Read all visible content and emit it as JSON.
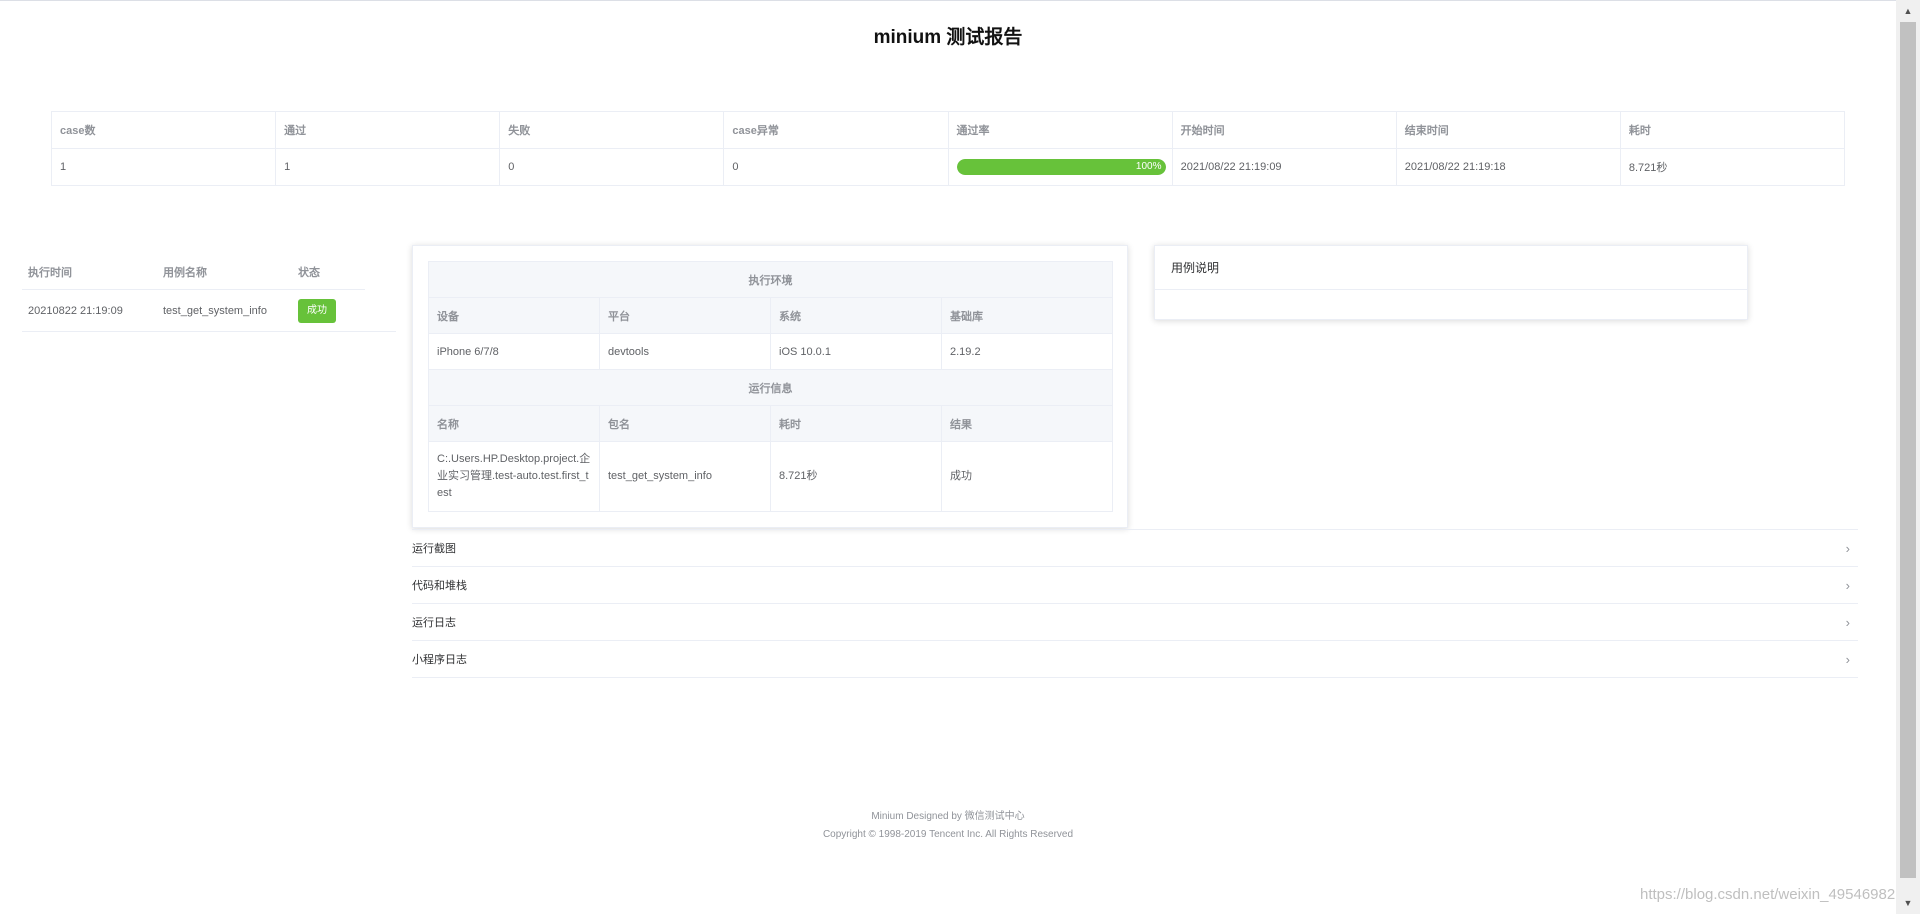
{
  "title": "minium 测试报告",
  "summary": {
    "headers": [
      "case数",
      "通过",
      "失败",
      "case异常",
      "通过率",
      "开始时间",
      "结束时间",
      "耗时"
    ],
    "case_count": "1",
    "passed": "1",
    "failed": "0",
    "errors": "0",
    "pass_rate": 1.0,
    "pass_rate_label": "100%",
    "start_time": "2021/08/22 21:19:09",
    "end_time": "2021/08/22 21:19:18",
    "duration": "8.721秒",
    "progress_color": "#67c23a"
  },
  "case_list": {
    "headers": [
      "执行时间",
      "用例名称",
      "状态"
    ],
    "rows": [
      {
        "time": "20210822 21:19:09",
        "name": "test_get_system_info",
        "status": "成功"
      }
    ]
  },
  "env": {
    "section_env": "执行环境",
    "env_headers": [
      "设备",
      "平台",
      "系统",
      "基础库"
    ],
    "env_values": [
      "iPhone 6/7/8",
      "devtools",
      "iOS 10.0.1",
      "2.19.2"
    ],
    "section_run": "运行信息",
    "run_headers": [
      "名称",
      "包名",
      "耗时",
      "结果"
    ],
    "run_values": [
      "C:.Users.HP.Desktop.project.企业实习管理.test-auto.test.first_test",
      "test_get_system_info",
      "8.721秒",
      "成功"
    ]
  },
  "desc": {
    "title": "用例说明"
  },
  "collapse": [
    "运行截图",
    "代码和堆栈",
    "运行日志",
    "小程序日志"
  ],
  "footer": {
    "line1": "Minium Designed by 微信测试中心",
    "line2": "Copyright © 1998-2019 Tencent Inc. All Rights Reserved"
  },
  "watermark": "https://blog.csdn.net/weixin_49546982"
}
